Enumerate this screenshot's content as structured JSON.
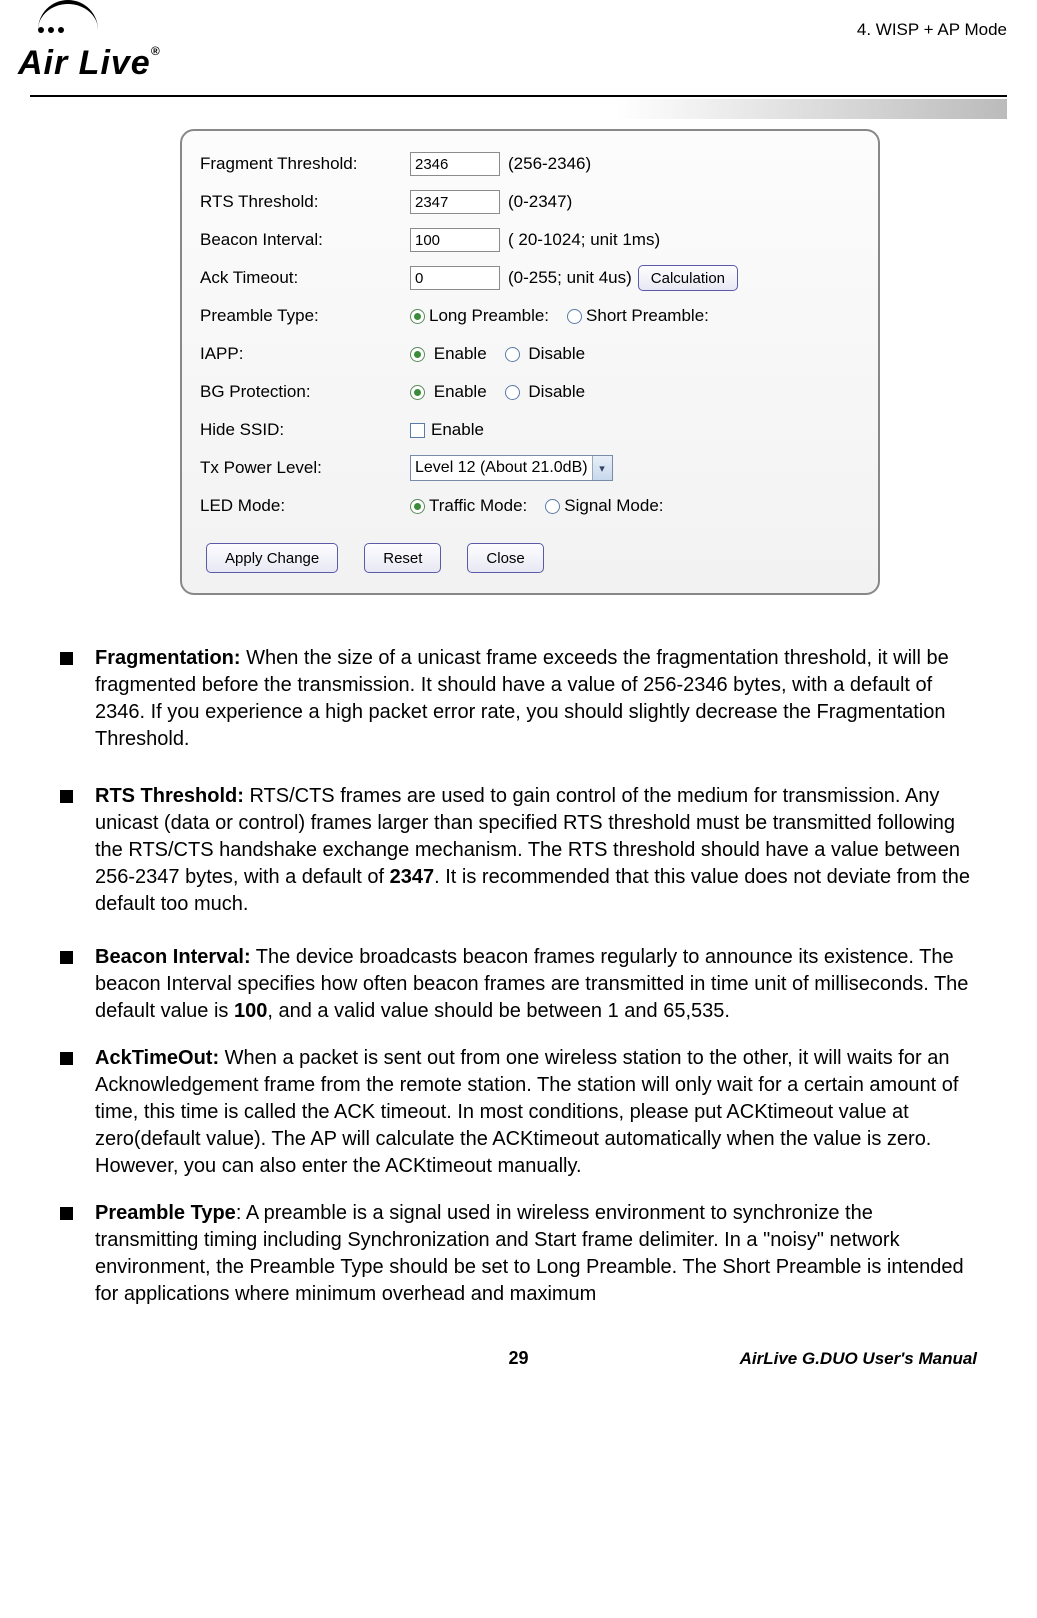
{
  "header": {
    "logo_text": "Air Live",
    "section": "4. WISP + AP Mode"
  },
  "panel": {
    "fragment": {
      "label": "Fragment Threshold:",
      "value": "2346",
      "hint": "(256-2346)"
    },
    "rts": {
      "label": "RTS Threshold:",
      "value": "2347",
      "hint": "(0-2347)"
    },
    "beacon": {
      "label": "Beacon Interval:",
      "value": "100",
      "hint": "( 20-1024; unit 1ms)"
    },
    "ack": {
      "label": "Ack Timeout:",
      "value": "0",
      "hint": "(0-255; unit 4us)",
      "button": "Calculation"
    },
    "preamble": {
      "label": "Preamble Type:",
      "opt1": "Long Preamble:",
      "opt2": "Short Preamble:"
    },
    "iapp": {
      "label": "IAPP:",
      "opt1": "Enable",
      "opt2": "Disable"
    },
    "bg": {
      "label": "BG Protection:",
      "opt1": "Enable",
      "opt2": "Disable"
    },
    "hide": {
      "label": "Hide SSID:",
      "opt1": "Enable"
    },
    "tx": {
      "label": "Tx Power Level:",
      "selected": "Level 12 (About 21.0dB)"
    },
    "led": {
      "label": "LED Mode:",
      "opt1": "Traffic Mode:",
      "opt2": "Signal Mode:"
    },
    "buttons": {
      "apply": "Apply Change",
      "reset": "Reset",
      "close": "Close"
    }
  },
  "bullets": {
    "frag": {
      "title": "Fragmentation:",
      "text": " When the size of a unicast frame exceeds the fragmentation threshold, it will be fragmented before the transmission. It should have a value of 256-2346 bytes, with a default of 2346.   If you experience a high packet error rate, you should slightly decrease the Fragmentation Threshold."
    },
    "rts": {
      "title": "RTS Threshold:",
      "text_a": " RTS/CTS frames are used to gain control of the medium for transmission. Any unicast (data or control) frames larger than specified RTS threshold must be transmitted following the RTS/CTS handshake exchange mechanism. The RTS threshold should have a value between 256-2347 bytes, with a default of ",
      "bold": "2347",
      "text_b": ". It is recommended that this value does not deviate from the default too much."
    },
    "beacon": {
      "title": "Beacon Interval:",
      "text_a": " The device broadcasts beacon frames regularly to announce its existence. The beacon Interval specifies how often beacon frames are transmitted in time unit of milliseconds. The default value is ",
      "bold": "100",
      "text_b": ", and a valid value should be between 1 and 65,535."
    },
    "ack": {
      "title": "AckTimeOut:",
      "text": "  When a packet is sent out from one wireless station to the other, it will waits for an Acknowledgement frame from the remote station.   The station will only wait for a certain amount of time, this time is called the ACK timeout.   In most conditions, please put ACKtimeout value at zero(default value).   The AP will calculate the ACKtimeout automatically when the value is zero.   However, you can also enter the ACKtimeout manually."
    },
    "preamble": {
      "title": "Preamble Type",
      "text": ": A preamble is a signal used in wireless environment to synchronize the transmitting timing including Synchronization and Start frame delimiter. In a \"noisy\" network environment, the Preamble Type should be set to Long Preamble. The Short Preamble is intended for applications where minimum overhead and maximum"
    }
  },
  "footer": {
    "page": "29",
    "manual": "AirLive G.DUO User's Manual"
  }
}
